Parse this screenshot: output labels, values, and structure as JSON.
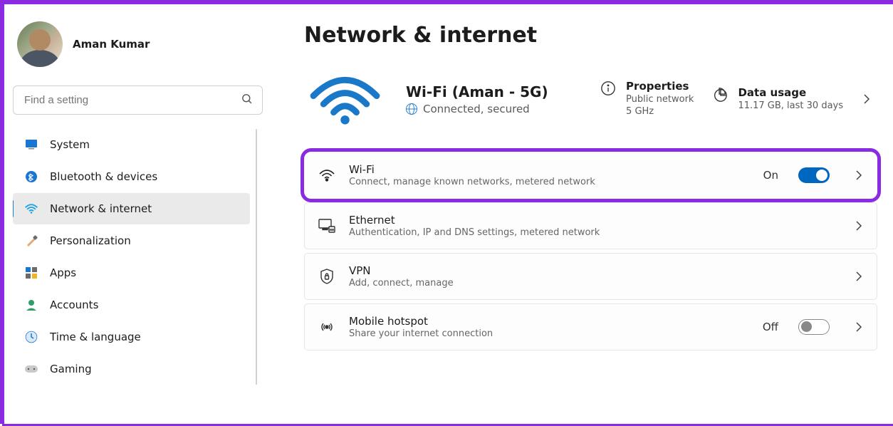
{
  "user": {
    "name": "Aman Kumar"
  },
  "search": {
    "placeholder": "Find a setting"
  },
  "sidebar": {
    "items": [
      {
        "icon": "system-icon",
        "label": "System"
      },
      {
        "icon": "bluetooth-icon",
        "label": "Bluetooth & devices"
      },
      {
        "icon": "wifi-icon",
        "label": "Network & internet",
        "active": true
      },
      {
        "icon": "brush-icon",
        "label": "Personalization"
      },
      {
        "icon": "apps-icon",
        "label": "Apps"
      },
      {
        "icon": "accounts-icon",
        "label": "Accounts"
      },
      {
        "icon": "time-icon",
        "label": "Time & language"
      },
      {
        "icon": "gaming-icon",
        "label": "Gaming"
      }
    ]
  },
  "page": {
    "title": "Network & internet"
  },
  "status": {
    "name": "Wi-Fi (Aman - 5G)",
    "state": "Connected, secured",
    "properties": {
      "title": "Properties",
      "sub": "Public network\n5 GHz"
    },
    "dataUsage": {
      "title": "Data usage",
      "sub": "11.17 GB, last 30 days"
    }
  },
  "rows": [
    {
      "icon": "wifi-row-icon",
      "title": "Wi-Fi",
      "sub": "Connect, manage known networks, metered network",
      "toggle": "On",
      "highlight": true
    },
    {
      "icon": "ethernet-icon",
      "title": "Ethernet",
      "sub": "Authentication, IP and DNS settings, metered network"
    },
    {
      "icon": "vpn-icon",
      "title": "VPN",
      "sub": "Add, connect, manage"
    },
    {
      "icon": "hotspot-icon",
      "title": "Mobile hotspot",
      "sub": "Share your internet connection",
      "toggle": "Off"
    }
  ]
}
